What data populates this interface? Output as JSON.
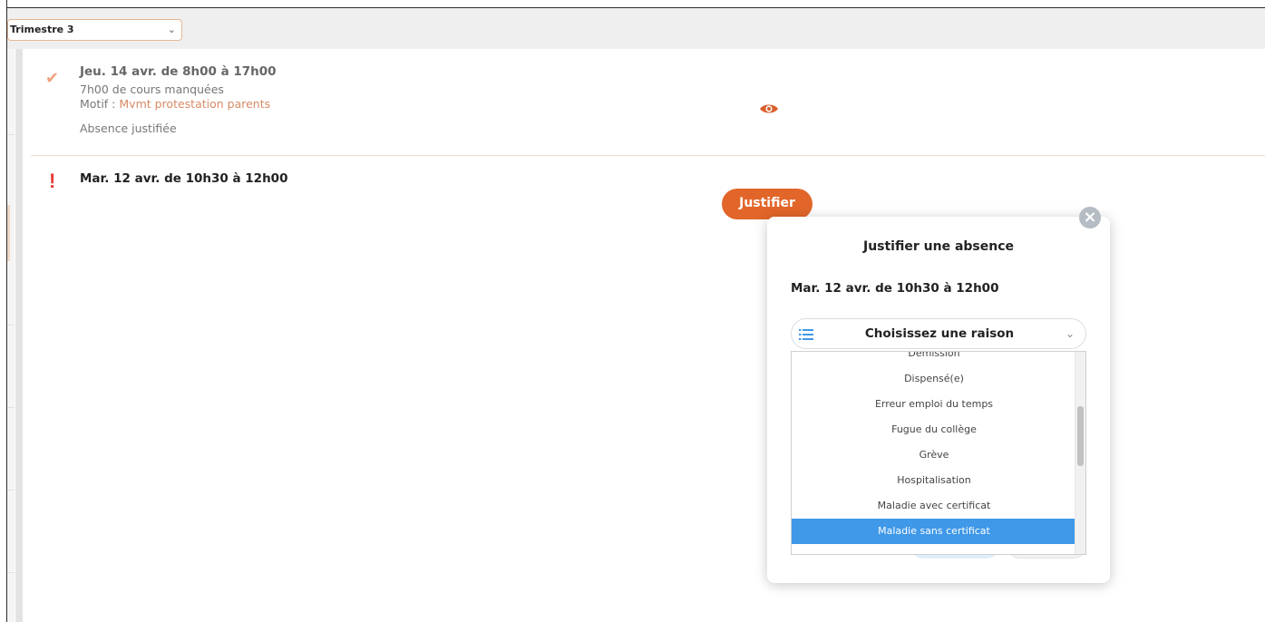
{
  "toolbar": {
    "period_select": {
      "value": "Trimestre 3"
    }
  },
  "absences": [
    {
      "status": "justified",
      "date": "Jeu. 14 avr. de 8h00 à 17h00",
      "missed": "7h00 de cours manquées",
      "motif_label": "Motif :",
      "motif_value": "Mvmt protestation parents",
      "state": "Absence justifiée",
      "icons": {
        "status": "check-icon",
        "action": "eye-icon"
      }
    },
    {
      "status": "unjustified",
      "date": "Mar. 12 avr. de 10h30 à 12h00",
      "action_label": "Justifier",
      "icons": {
        "status": "exclamation-icon"
      }
    }
  ],
  "modal": {
    "title": "Justifier une absence",
    "date": "Mar. 12 avr. de 10h30 à 12h00",
    "reason_select": {
      "placeholder": "Choisissez une raison",
      "icon": "list-icon"
    },
    "dropdown": {
      "options": [
        "Démission",
        "Dispensé(e)",
        "Erreur emploi du temps",
        "Fugue du collège",
        "Grève",
        "Hospitalisation",
        "Maladie avec certificat",
        "Maladie sans certificat"
      ],
      "highlighted": "Maladie sans certificat"
    }
  },
  "colors": {
    "accent": "#e2662a",
    "motif": "#d88a66",
    "error": "#e53935",
    "selection": "#3f98e8",
    "toolbar_bg": "#efefef"
  }
}
